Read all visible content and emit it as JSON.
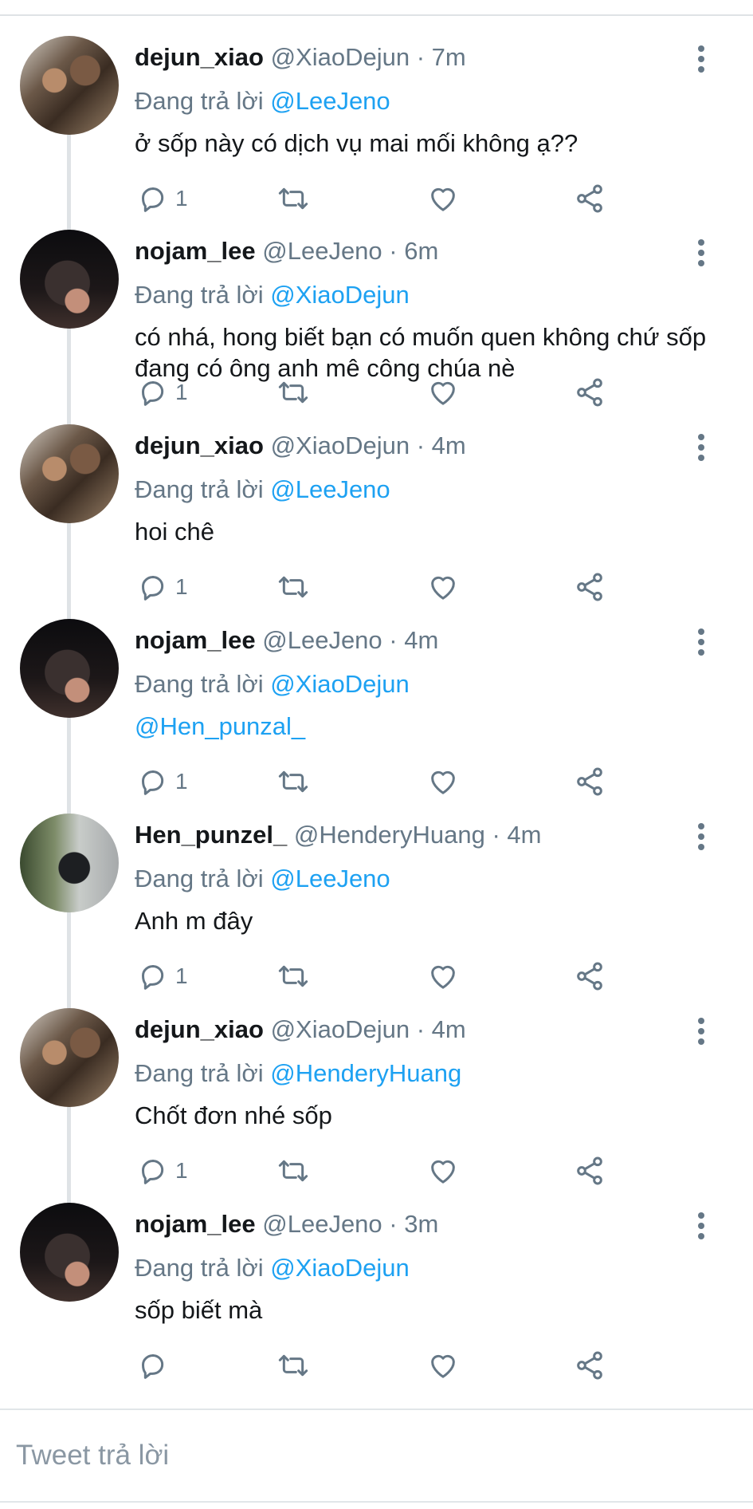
{
  "tweets": [
    {
      "display_name": "dejun_xiao",
      "handle": "@XiaoDejun",
      "separator": "·",
      "time": "7m",
      "reply_prefix": "Đang trả lời",
      "reply_to": "@LeeJeno",
      "text": "ở sốp này có dịch vụ mai mối không ạ??",
      "reply_count": "1",
      "avatar": "dejun"
    },
    {
      "display_name": "nojam_lee",
      "handle": "@LeeJeno",
      "separator": "·",
      "time": "6m",
      "reply_prefix": "Đang trả lời",
      "reply_to": "@XiaoDejun",
      "text": "có nhá, hong biết bạn có muốn quen không chứ sốp đang có ông anh mê công chúa nè",
      "reply_count": "1",
      "avatar": "nojam"
    },
    {
      "display_name": "dejun_xiao",
      "handle": "@XiaoDejun",
      "separator": "·",
      "time": "4m",
      "reply_prefix": "Đang trả lời",
      "reply_to": "@LeeJeno",
      "text": "hoi chê",
      "reply_count": "1",
      "avatar": "dejun"
    },
    {
      "display_name": "nojam_lee",
      "handle": "@LeeJeno",
      "separator": "·",
      "time": "4m",
      "reply_prefix": "Đang trả lời",
      "reply_to": "@XiaoDejun",
      "text": "@Hen_punzal_",
      "text_is_mention": true,
      "reply_count": "1",
      "avatar": "nojam"
    },
    {
      "display_name": "Hen_punzel_",
      "handle": "@HenderyHuang",
      "separator": "·",
      "time": "4m",
      "reply_prefix": "Đang trả lời",
      "reply_to": "@LeeJeno",
      "text": "Anh m đây",
      "reply_count": "1",
      "avatar": "hen"
    },
    {
      "display_name": "dejun_xiao",
      "handle": "@XiaoDejun",
      "separator": "·",
      "time": "4m",
      "reply_prefix": "Đang trả lời",
      "reply_to": "@HenderyHuang",
      "text": "Chốt đơn nhé sốp",
      "reply_count": "1",
      "avatar": "dejun"
    },
    {
      "display_name": "nojam_lee",
      "handle": "@LeeJeno",
      "separator": "·",
      "time": "3m",
      "reply_prefix": "Đang trả lời",
      "reply_to": "@XiaoDejun",
      "text": "sốp biết mà",
      "reply_count": "",
      "avatar": "nojam"
    }
  ],
  "icons": {
    "reply": "reply-icon",
    "retweet": "retweet-icon",
    "like": "heart-icon",
    "share": "share-icon",
    "more": "more-vertical-icon"
  },
  "colors": {
    "mention": "#1da1f2",
    "secondary_text": "#657786",
    "icon": "#657786",
    "thread_line": "#dfe3e6"
  },
  "compose": {
    "placeholder": "Tweet trả lời"
  }
}
